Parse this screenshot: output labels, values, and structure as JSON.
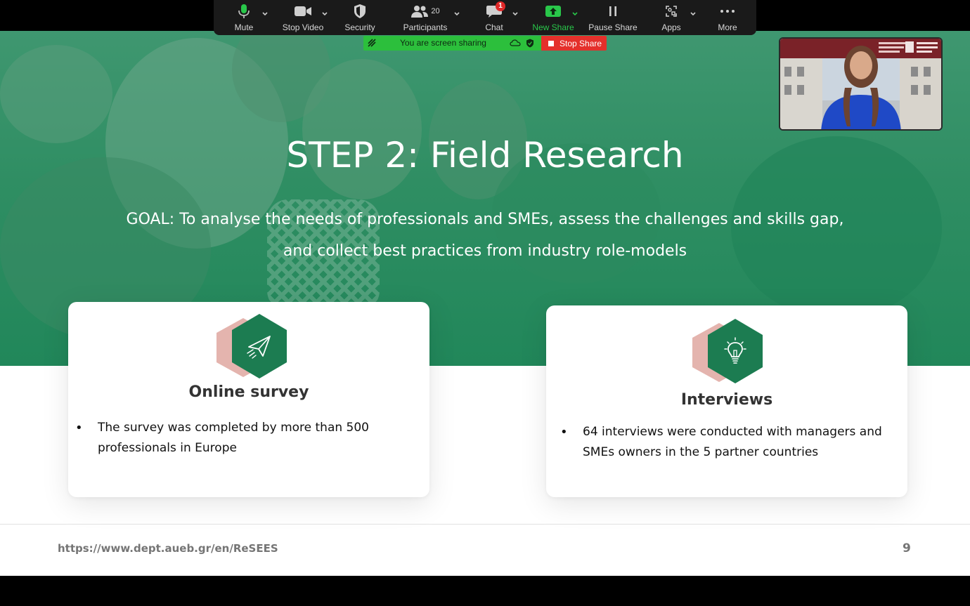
{
  "toolbar": {
    "mute": "Mute",
    "stop_video": "Stop Video",
    "security": "Security",
    "participants": "Participants",
    "participants_count": "20",
    "chat": "Chat",
    "chat_badge": "1",
    "new_share": "New Share",
    "pause_share": "Pause Share",
    "apps": "Apps",
    "more": "More"
  },
  "sharing": {
    "status": "You are screen sharing",
    "stop": "Stop Share"
  },
  "slide": {
    "title": "STEP 2: Field Research",
    "goal_line1": "GOAL: To analyse the needs of professionals and SMEs, assess the challenges and skills gap,",
    "goal_line2": "and collect best practices from industry role-models",
    "cards": [
      {
        "heading": "Online survey",
        "icon": "paper-plane-icon",
        "bullet_line1": "The survey was completed by more than 500",
        "bullet_line2": "professionals in Europe"
      },
      {
        "heading": "Interviews",
        "icon": "lightbulb-icon",
        "bullet_line1": "64 interviews were conducted with managers and",
        "bullet_line2": "SMEs owners in the 5 partner countries"
      }
    ],
    "footer_url": "https://www.dept.aueb.gr/en/ReSEES",
    "page_number": "9"
  },
  "colors": {
    "hero_green": "#2f8e63",
    "hex_green": "#1c7c51",
    "hex_pink": "#e4b4ae",
    "share_green": "#2cbf3c",
    "stop_red": "#e4302b",
    "toolbar_bg": "#1a1a1a"
  }
}
